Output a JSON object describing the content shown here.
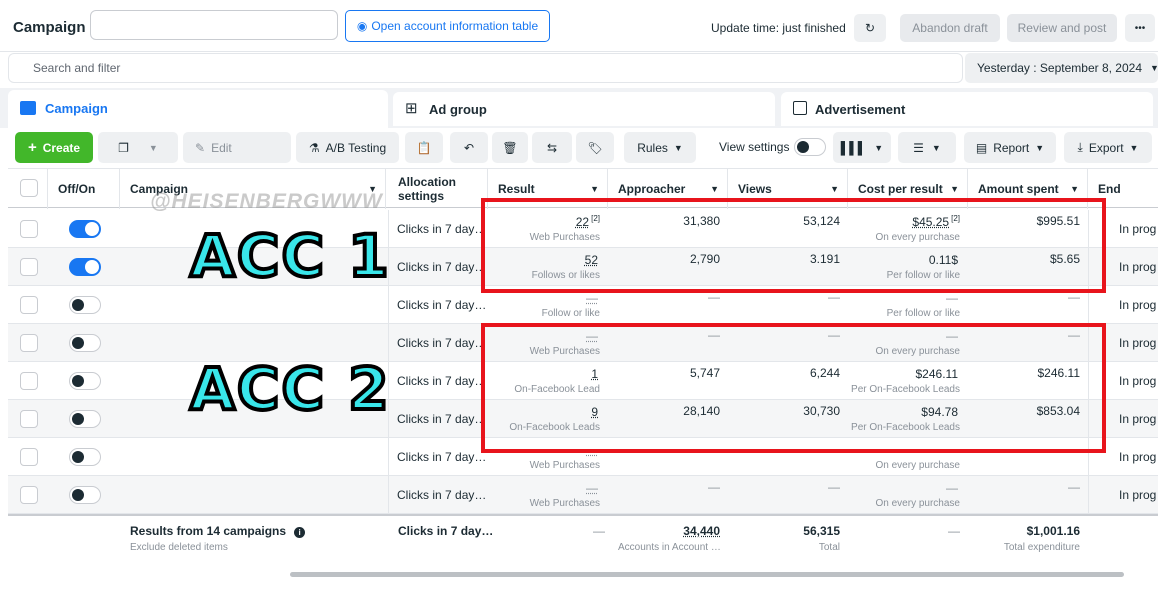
{
  "header": {
    "title": "Campaign",
    "open_table": "Open account information table",
    "update_time": "Update time: just finished",
    "abandon": "Abandon draft",
    "review": "Review and post",
    "more": "•••"
  },
  "search": {
    "placeholder": "Search and filter",
    "date": "Yesterday : September 8, 2024"
  },
  "tabs": [
    {
      "label": "Campaign"
    },
    {
      "label": "Ad group"
    },
    {
      "label": "Advertisement"
    }
  ],
  "toolbar": {
    "create": "Create",
    "edit": "Edit",
    "ab": "A/B Testing",
    "rules": "Rules",
    "view_settings": "View settings",
    "report": "Report",
    "export": "Export"
  },
  "columns": [
    "Off/On",
    "Campaign",
    "Allocation settings",
    "Result",
    "Approacher",
    "Views",
    "Cost per result",
    "Amount spent",
    "End"
  ],
  "rows": [
    {
      "on": true,
      "alloc": "Clicks in 7 day…",
      "result": "22",
      "result_sup": "[2]",
      "result_sub": "Web Purchases",
      "approacher": "31,380",
      "views": "53,124",
      "cost": "$45.25",
      "cost_sup": "[2]",
      "cost_sub": "On every purchase",
      "spent": "$995.51",
      "end": "In prog"
    },
    {
      "on": true,
      "alloc": "Clicks in 7 day…",
      "result": "52",
      "result_sup": "",
      "result_sub": "Follows or likes",
      "approacher": "2,790",
      "views": "3.191",
      "cost": "0.11$",
      "cost_sup": "",
      "cost_sub": "Per follow or like",
      "spent": "$5.65",
      "end": "In prog"
    },
    {
      "on": false,
      "alloc": "Clicks in 7 day…",
      "result": "—",
      "result_sup": "",
      "result_sub": "Follow or like",
      "approacher": "—",
      "views": "—",
      "cost": "—",
      "cost_sup": "",
      "cost_sub": "Per follow or like",
      "spent": "—",
      "end": "In prog"
    },
    {
      "on": false,
      "alloc": "Clicks in 7 day…",
      "result": "—",
      "result_sup": "",
      "result_sub": "Web Purchases",
      "approacher": "—",
      "views": "—",
      "cost": "—",
      "cost_sup": "",
      "cost_sub": "On every purchase",
      "spent": "—",
      "end": "In prog"
    },
    {
      "on": false,
      "alloc": "Clicks in 7 day…",
      "result": "1",
      "result_sup": "",
      "result_sub": "On-Facebook Lead",
      "approacher": "5,747",
      "views": "6,244",
      "cost": "$246.11",
      "cost_sup": "",
      "cost_sub": "Per On-Facebook Leads",
      "spent": "$246.11",
      "end": "In prog"
    },
    {
      "on": false,
      "alloc": "Clicks in 7 day…",
      "result": "9",
      "result_sup": "",
      "result_sub": "On-Facebook Leads",
      "approacher": "28,140",
      "views": "30,730",
      "cost": "$94.78",
      "cost_sup": "",
      "cost_sub": "Per On-Facebook Leads",
      "spent": "$853.04",
      "end": "In prog"
    },
    {
      "on": false,
      "alloc": "Clicks in 7 day…",
      "result": "—",
      "result_sup": "",
      "result_sub": "Web Purchases",
      "approacher": "—",
      "views": "—",
      "cost": "—",
      "cost_sup": "",
      "cost_sub": "On every purchase",
      "spent": "—",
      "end": "In prog"
    },
    {
      "on": false,
      "alloc": "Clicks in 7 day…",
      "result": "—",
      "result_sup": "",
      "result_sub": "Web Purchases",
      "approacher": "—",
      "views": "—",
      "cost": "—",
      "cost_sup": "",
      "cost_sub": "On every purchase",
      "spent": "—",
      "end": "In prog"
    }
  ],
  "footer": {
    "title": "Results from 14 campaigns",
    "sub": "Exclude deleted items",
    "alloc": "Clicks in 7 day…",
    "result": "—",
    "approacher": "34,440",
    "approacher_sub": "Accounts in Account …",
    "views": "56,315",
    "views_sub": "Total",
    "cost": "—",
    "spent": "$1,001.16",
    "spent_sub": "Total expenditure"
  },
  "overlay": {
    "acc1": "ACC 1",
    "acc2": "ACC 2",
    "watermark": "@HEISENBERGWWW"
  },
  "colors": {
    "accent": "#1877f2",
    "create": "#42b72a",
    "highlight": "#e8141c",
    "overlay_text": "#39e6ea"
  }
}
